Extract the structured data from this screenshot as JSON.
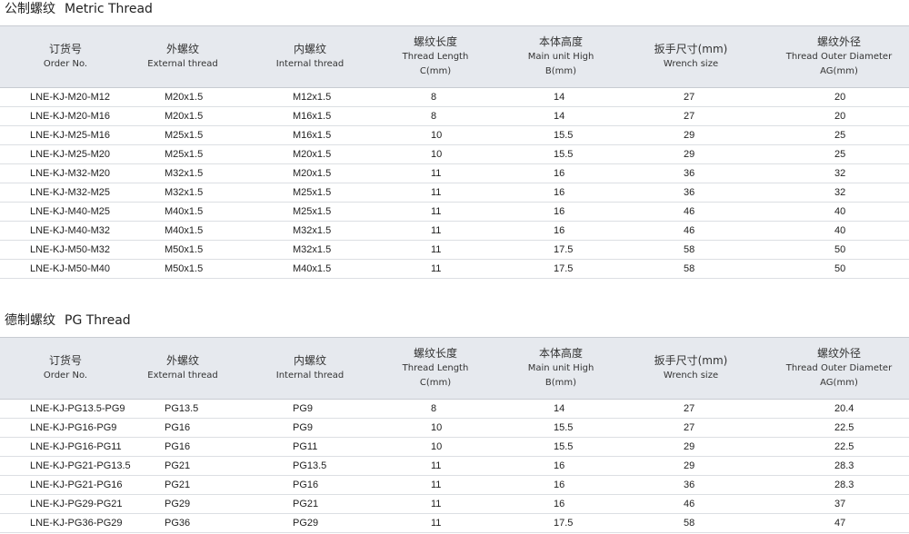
{
  "metric": {
    "title_zh": "公制螺纹",
    "title_en": "Metric Thread",
    "headers": [
      {
        "zh": "订货号",
        "en": [
          "Order No."
        ]
      },
      {
        "zh": "外螺纹",
        "en": [
          "External thread"
        ]
      },
      {
        "zh": "内螺纹",
        "en": [
          "Internal thread"
        ]
      },
      {
        "zh": "螺纹长度",
        "en": [
          "Thread Length",
          "C(mm)"
        ]
      },
      {
        "zh": "本体高度",
        "en": [
          "Main unit High",
          "B(mm)"
        ]
      },
      {
        "zh": "扳手尺寸(mm)",
        "en": [
          "Wrench size"
        ]
      },
      {
        "zh": "螺纹外径",
        "en": [
          "Thread Outer Diameter",
          "AG(mm)"
        ]
      }
    ],
    "rows": [
      [
        "LNE-KJ-M20-M12",
        "M20x1.5",
        "M12x1.5",
        "8",
        "14",
        "27",
        "20"
      ],
      [
        "LNE-KJ-M20-M16",
        "M20x1.5",
        "M16x1.5",
        "8",
        "14",
        "27",
        "20"
      ],
      [
        "LNE-KJ-M25-M16",
        "M25x1.5",
        "M16x1.5",
        "10",
        "15.5",
        "29",
        "25"
      ],
      [
        "LNE-KJ-M25-M20",
        "M25x1.5",
        "M20x1.5",
        "10",
        "15.5",
        "29",
        "25"
      ],
      [
        "LNE-KJ-M32-M20",
        "M32x1.5",
        "M20x1.5",
        "11",
        "16",
        "36",
        "32"
      ],
      [
        "LNE-KJ-M32-M25",
        "M32x1.5",
        "M25x1.5",
        "11",
        "16",
        "36",
        "32"
      ],
      [
        "LNE-KJ-M40-M25",
        "M40x1.5",
        "M25x1.5",
        "11",
        "16",
        "46",
        "40"
      ],
      [
        "LNE-KJ-M40-M32",
        "M40x1.5",
        "M32x1.5",
        "11",
        "16",
        "46",
        "40"
      ],
      [
        "LNE-KJ-M50-M32",
        "M50x1.5",
        "M32x1.5",
        "11",
        "17.5",
        "58",
        "50"
      ],
      [
        "LNE-KJ-M50-M40",
        "M50x1.5",
        "M40x1.5",
        "11",
        "17.5",
        "58",
        "50"
      ]
    ]
  },
  "pg": {
    "title_zh": "德制螺纹",
    "title_en": "PG Thread",
    "headers": [
      {
        "zh": "订货号",
        "en": [
          "Order No."
        ]
      },
      {
        "zh": "外螺纹",
        "en": [
          "External thread"
        ]
      },
      {
        "zh": "内螺纹",
        "en": [
          "Internal thread"
        ]
      },
      {
        "zh": "螺纹长度",
        "en": [
          "Thread Length",
          "C(mm)"
        ]
      },
      {
        "zh": "本体高度",
        "en": [
          "Main unit High",
          "B(mm)"
        ]
      },
      {
        "zh": "扳手尺寸(mm)",
        "en": [
          "Wrench size"
        ]
      },
      {
        "zh": "螺纹外径",
        "en": [
          "Thread Outer Diameter",
          "AG(mm)"
        ]
      }
    ],
    "rows": [
      [
        "LNE-KJ-PG13.5-PG9",
        "PG13.5",
        "PG9",
        "8",
        "14",
        "27",
        "20.4"
      ],
      [
        "LNE-KJ-PG16-PG9",
        "PG16",
        "PG9",
        "10",
        "15.5",
        "27",
        "22.5"
      ],
      [
        "LNE-KJ-PG16-PG11",
        "PG16",
        "PG11",
        "10",
        "15.5",
        "29",
        "22.5"
      ],
      [
        "LNE-KJ-PG21-PG13.5",
        "PG21",
        "PG13.5",
        "11",
        "16",
        "29",
        "28.3"
      ],
      [
        "LNE-KJ-PG21-PG16",
        "PG21",
        "PG16",
        "11",
        "16",
        "36",
        "28.3"
      ],
      [
        "LNE-KJ-PG29-PG21",
        "PG29",
        "PG21",
        "11",
        "16",
        "46",
        "37"
      ],
      [
        "LNE-KJ-PG36-PG29",
        "PG36",
        "PG29",
        "11",
        "17.5",
        "58",
        "47"
      ]
    ]
  }
}
